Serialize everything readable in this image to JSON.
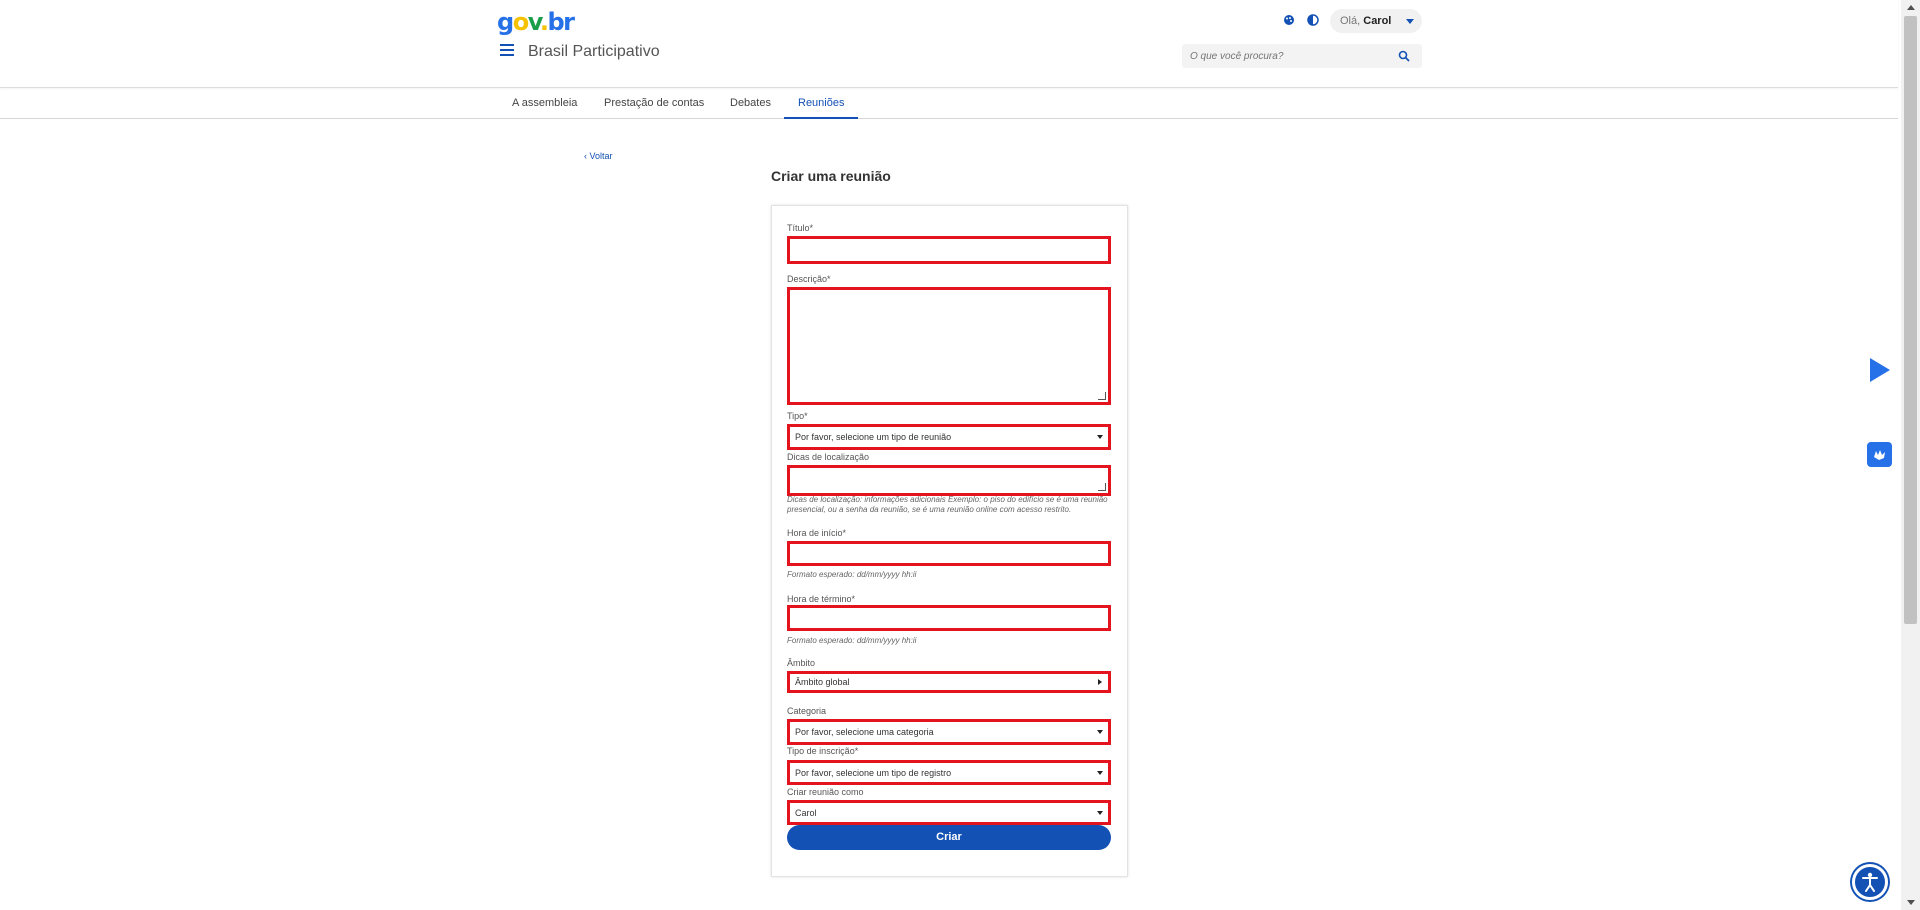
{
  "header": {
    "logo": {
      "g": "g",
      "o": "o",
      "v": "v",
      "dot": ".",
      "br": "br"
    },
    "site_title": "Brasil Participativo",
    "greeting": "Olá,",
    "user_name": "Carol",
    "search_placeholder": "O que você procura?"
  },
  "tabs": [
    "A assembleia",
    "Prestação de contas",
    "Debates",
    "Reuniões"
  ],
  "active_tab": "Reuniões",
  "back_label": "Voltar",
  "page_title": "Criar uma reunião",
  "form": {
    "titulo_label": "Título*",
    "descricao_label": "Descrição*",
    "tipo_label": "Tipo*",
    "tipo_value": "Por favor, selecione um tipo de reunião",
    "dicas_label": "Dicas de localização",
    "dicas_hint": "Dicas de localização: informações adicionais Exemplo: o piso do edifício se é uma reunião presencial, ou a senha da reunião, se é uma reunião online com acesso restrito.",
    "hora_inicio_label": "Hora de início*",
    "hora_inicio_hint": "Formato esperado: dd/mm/yyyy hh:ii",
    "hora_termino_label": "Hora de término*",
    "hora_termino_hint": "Formato esperado: dd/mm/yyyy hh:ii",
    "ambito_label": "Âmbito",
    "ambito_value": "Âmbito global",
    "categoria_label": "Categoria",
    "categoria_value": "Por favor, selecione uma categoria",
    "inscricao_label": "Tipo de inscrição*",
    "inscricao_value": "Por favor, selecione um tipo de registro",
    "criar_como_label": "Criar reunião como",
    "criar_como_value": "Carol",
    "submit_label": "Criar"
  },
  "colors": {
    "primary": "#1351b4",
    "error_border": "#e3141e",
    "accent_blue": "#2670e8"
  },
  "icons": [
    "menu-icon",
    "palette-icon",
    "contrast-icon",
    "search-icon",
    "chevron-left-icon",
    "play-icon",
    "vlibras-icon",
    "accessibility-icon"
  ]
}
